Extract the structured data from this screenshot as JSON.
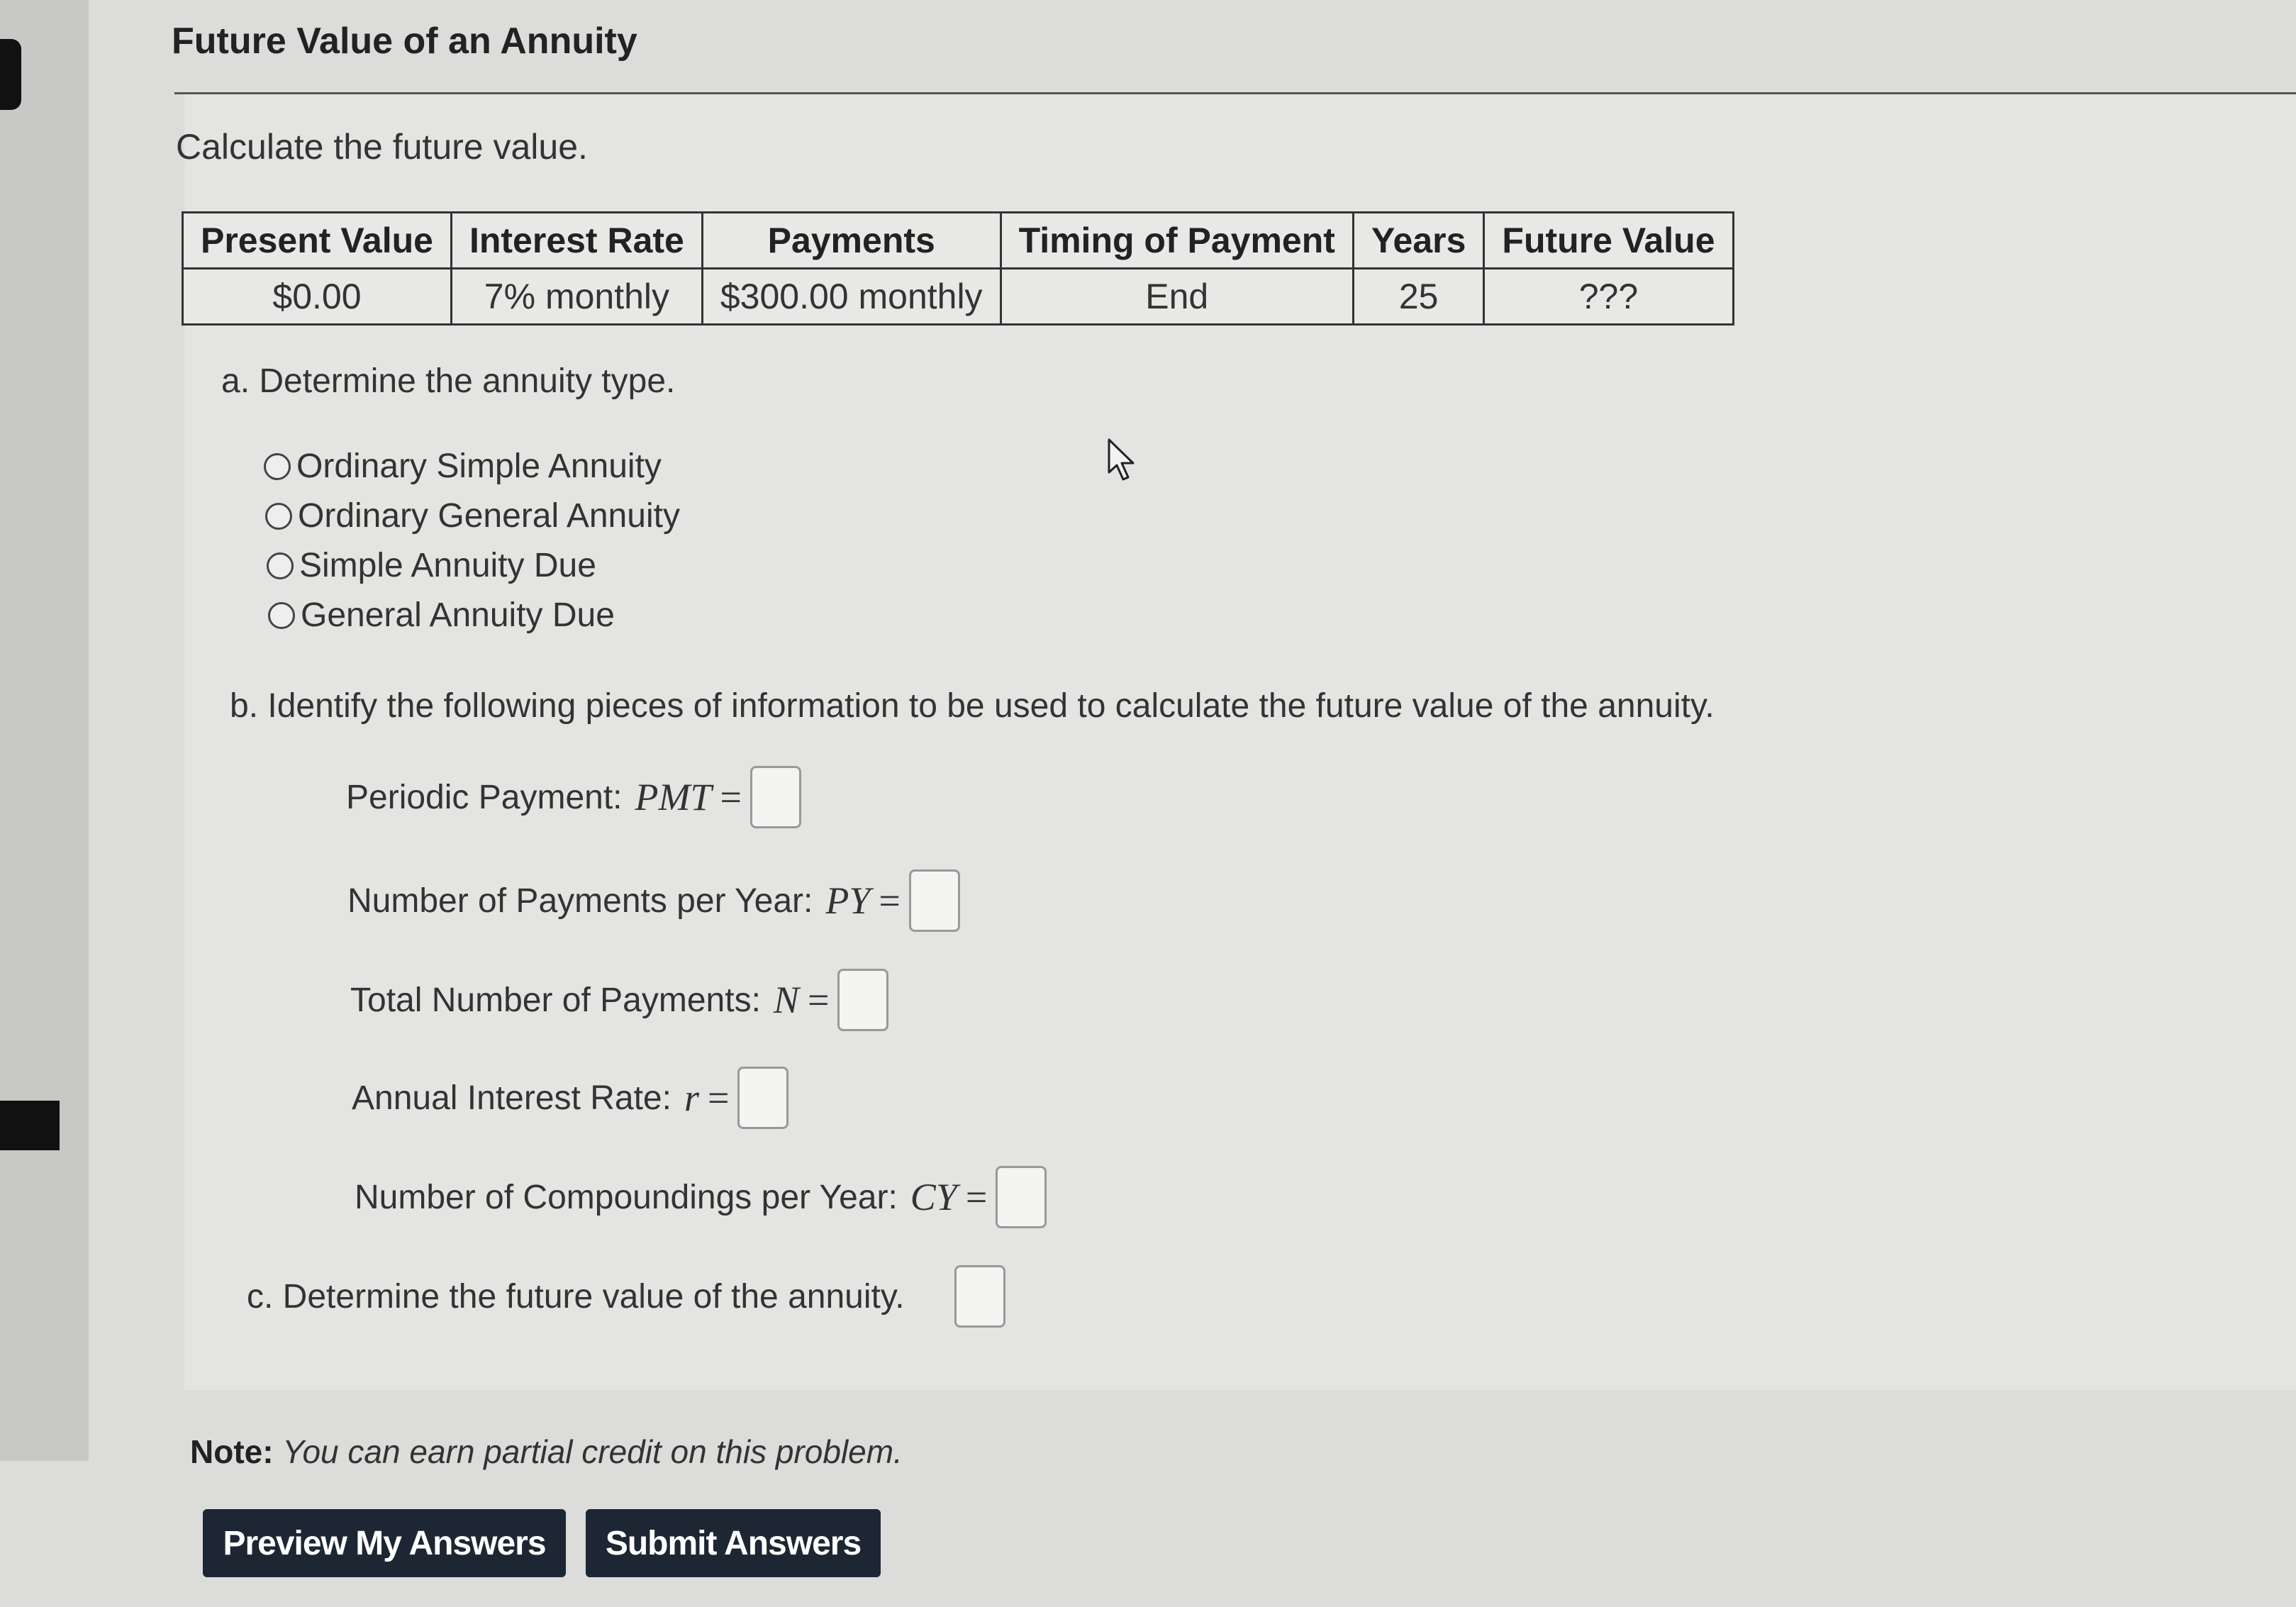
{
  "title": "Future Value of an Annuity",
  "instruction": "Calculate the future value.",
  "table": {
    "headers": [
      "Present Value",
      "Interest Rate",
      "Payments",
      "Timing of Payment",
      "Years",
      "Future Value"
    ],
    "row": [
      "$0.00",
      "7% monthly",
      "$300.00 monthly",
      "End",
      "25",
      "???"
    ]
  },
  "part_a": {
    "prompt": "a. Determine the annuity type.",
    "options": [
      "Ordinary Simple Annuity",
      "Ordinary General Annuity",
      "Simple Annuity Due",
      "General Annuity Due"
    ]
  },
  "part_b": {
    "prompt": "b. Identify the following pieces of information to be used to calculate the future value of the annuity.",
    "fields": [
      {
        "label": "Periodic Payment:",
        "symbol": "PMT"
      },
      {
        "label": "Number of Payments per Year:",
        "symbol": "PY"
      },
      {
        "label": "Total Number of Payments:",
        "symbol": "N"
      },
      {
        "label": "Annual Interest Rate:",
        "symbol": "r"
      },
      {
        "label": "Number of Compoundings per Year:",
        "symbol": "CY"
      }
    ],
    "equals": "="
  },
  "part_c": {
    "prompt": "c. Determine the future value of the annuity."
  },
  "note": {
    "label": "Note:",
    "text": "You can earn partial credit on this problem."
  },
  "buttons": {
    "preview": "Preview My Answers",
    "submit": "Submit Answers"
  }
}
